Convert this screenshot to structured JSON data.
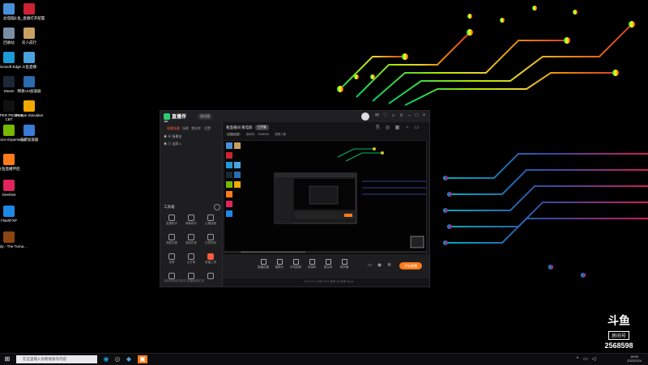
{
  "desktop": {
    "icons": [
      {
        "label": "此电脑",
        "color": "#4a90d9"
      },
      {
        "label": "斗鱼_直播打开配置",
        "color": "#c23"
      },
      {
        "label": "回收站",
        "color": "#7a8fa6"
      },
      {
        "label": "双人成行",
        "color": "#c8a060"
      },
      {
        "label": "Microsoft Edge",
        "color": "#1e9bd7"
      },
      {
        "label": "斗鱼直播",
        "color": "#4aa3df"
      },
      {
        "label": "Steam",
        "color": "#1b2838"
      },
      {
        "label": "网易UU加速器",
        "color": "#2b6cb0"
      },
      {
        "label": "SUPER PEOPLE CBT",
        "color": "#111"
      },
      {
        "label": "Escape Simulator",
        "color": "#f2a900"
      },
      {
        "label": "GeForce Experience",
        "color": "#76b900"
      },
      {
        "label": "迅游加速器",
        "color": "#3a7bd5"
      },
      {
        "label": "斗鱼直播伴侣",
        "color": "#ff7a1a"
      },
      {
        "label": "GeeGee",
        "color": "#e0245e"
      },
      {
        "label": "FlashFXP",
        "color": "#1e88e5"
      },
      {
        "label": "Nobody - The Turna...",
        "color": "#8b4513"
      }
    ]
  },
  "app": {
    "logo_text": "直播伴侣",
    "version": "测试版",
    "left_tabs": [
      "观看场景",
      "场景",
      "素材库",
      "设置"
    ],
    "scenes": [
      "场景名",
      "全屏 1"
    ],
    "tools_title": "工具箱",
    "tools": [
      "直播助手",
      "弹幕助手",
      "云播放器",
      "观看设置",
      "虚拟形象",
      "礼物特效",
      "录屏",
      "云打榜",
      "录播工具",
      "",
      "",
      ""
    ],
    "status_left": "当前网络状况良好 直播音频正常",
    "room_title": "看直播间 看电影",
    "room_badge": "已开播",
    "meta": [
      "切换分类",
      "房间号",
      "2568598",
      "观看人数"
    ],
    "bottom_buttons": [
      "直播设置",
      "摄像头",
      "手机投屏",
      "多媒体",
      "麦克风",
      "扬声器"
    ],
    "start_label": "开始直播",
    "status_right": "CPU 12%  内存 45%  帧率 60  码率 0kb/s"
  },
  "taskbar": {
    "search_placeholder": "在这里输入你要搜索的内容",
    "time": "18:00",
    "date": "2022/2/24"
  },
  "watermark": {
    "brand": "斗鱼",
    "label": "房间号",
    "room_number": "2568598"
  }
}
